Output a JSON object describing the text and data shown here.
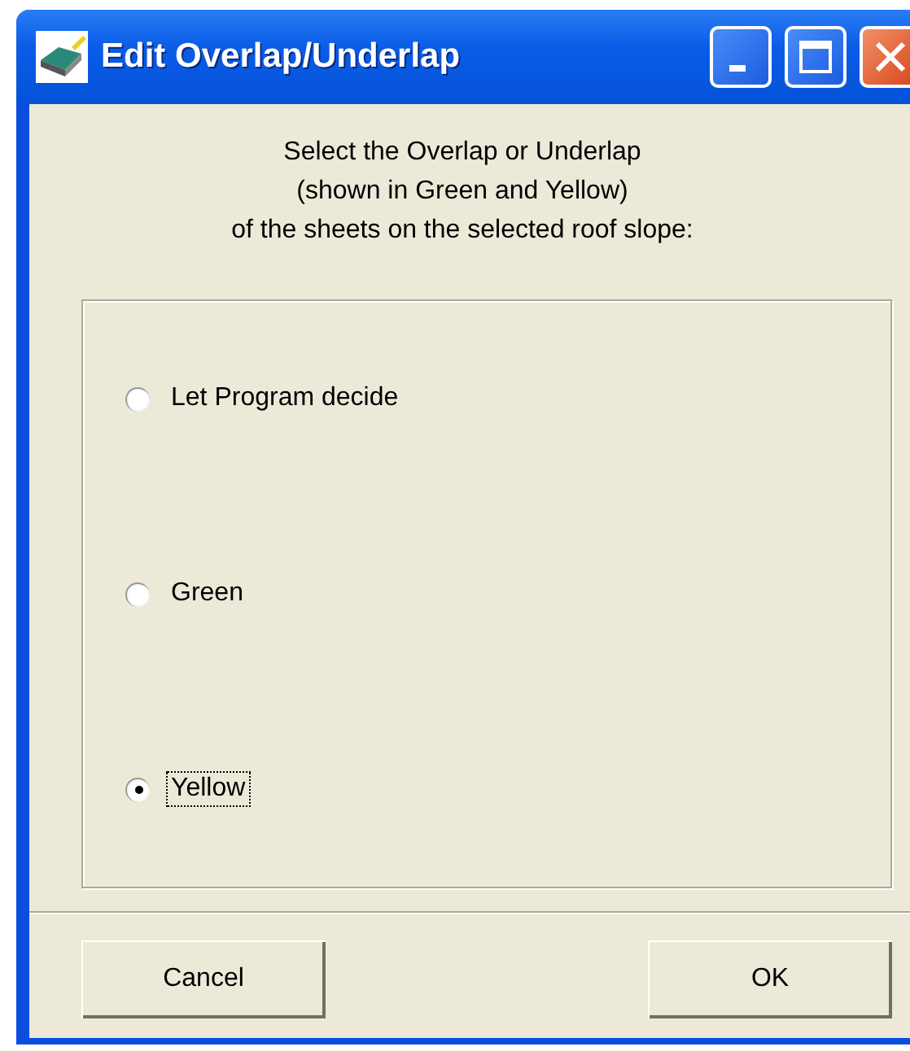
{
  "window": {
    "title": "Edit Overlap/Underlap"
  },
  "instructions": [
    "Select the Overlap or Underlap",
    "(shown in Green and Yellow)",
    "of the sheets on the selected roof slope:"
  ],
  "options": [
    {
      "label": "Let Program decide",
      "selected": false,
      "focused": false
    },
    {
      "label": "Green",
      "selected": false,
      "focused": false
    },
    {
      "label": "Yellow",
      "selected": true,
      "focused": true
    }
  ],
  "buttons": [
    "Cancel",
    "OK"
  ]
}
